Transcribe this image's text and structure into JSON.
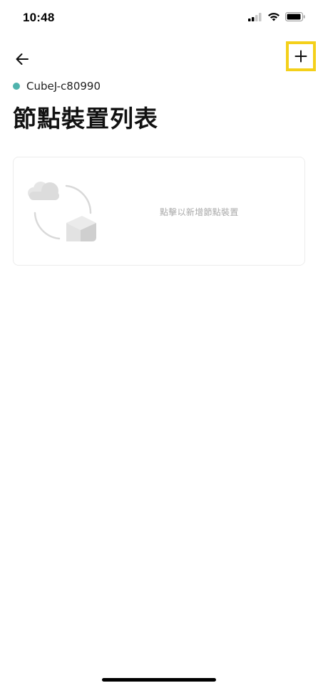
{
  "status_bar": {
    "time": "10:48",
    "icons": [
      "cellular-signal-icon",
      "wifi-icon",
      "battery-icon"
    ]
  },
  "nav": {
    "back_icon": "arrow-left-icon",
    "add_icon": "plus-icon",
    "add_highlight_color": "#f4d01a"
  },
  "device": {
    "name": "CubeJ-c80990",
    "status_color": "#4fb3ad"
  },
  "page": {
    "title": "節點裝置列表"
  },
  "empty_card": {
    "illustration": "cloud-to-box-sync-illustration",
    "hint": "點擊以新增節點裝置"
  }
}
